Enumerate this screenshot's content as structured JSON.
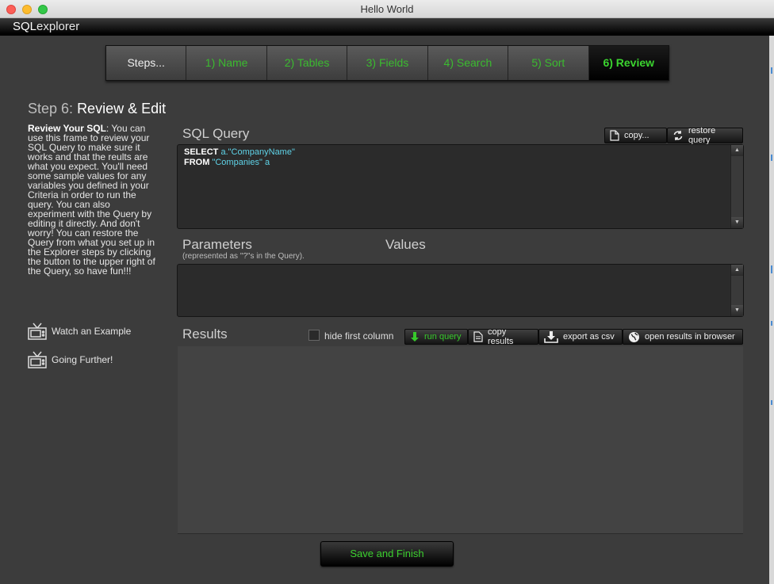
{
  "window": {
    "title": "Hello World"
  },
  "app": {
    "logo_prefix": "SQL",
    "logo_suffix": "explorer"
  },
  "steps": [
    {
      "label": "Steps..."
    },
    {
      "label": "1) Name"
    },
    {
      "label": "2) Tables"
    },
    {
      "label": "3) Fields"
    },
    {
      "label": "4) Search"
    },
    {
      "label": "5) Sort"
    },
    {
      "label": "6) Review"
    }
  ],
  "heading": {
    "prefix": "Step 6:",
    "title": "Review & Edit"
  },
  "help": {
    "lead": "Review Your SQL",
    "body": ":  You can use this frame to review your SQL Query to make sure it works and that the reults are what you expect.  You'll need some sample values for any variables you defined in your Criteria in order to run the query.  You can also experiment with the Query by editing it directly.  And don't worry! You can restore the Query from what you set up in the Explorer steps by clicking the button to the upper right of the Query, so have fun!!!"
  },
  "links": {
    "watch": "Watch an Example",
    "further": "Going Further!"
  },
  "query": {
    "label": "SQL Query",
    "copy_label": "copy...",
    "restore_label": "restore query",
    "line1_kw": "SELECT",
    "line1_val": "a.\"CompanyName\"",
    "line2_kw": "FROM",
    "line2_val": "\"Companies\"",
    "line2_alias": "a"
  },
  "params": {
    "label": "Parameters",
    "sublabel": "(represented as \"?\"s in the Query).",
    "values_label": "Values"
  },
  "results": {
    "label": "Results",
    "hide_first_column": "hide first column",
    "run_query": "run query",
    "copy_results": "copy results",
    "export_csv": "export as csv",
    "open_browser": "open results in browser"
  },
  "save_label": "Save and Finish"
}
